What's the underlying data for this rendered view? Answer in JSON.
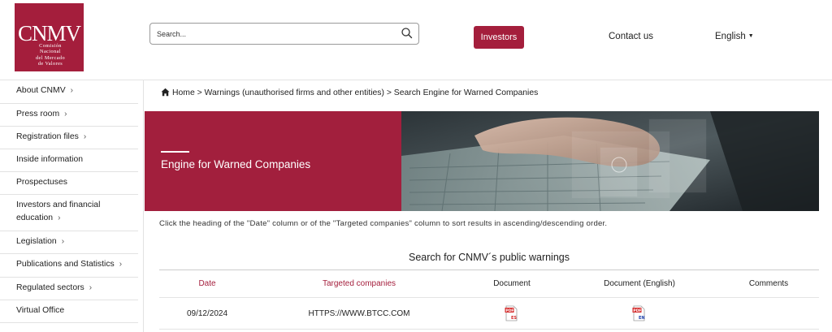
{
  "logo": {
    "brand": "CNMV",
    "lines": [
      "Comisión",
      "Nacional",
      "del Mercado",
      "de Valores"
    ]
  },
  "search": {
    "placeholder": "Search..."
  },
  "header": {
    "investors_label": "Investors",
    "contact_label": "Contact us",
    "language_label": "English"
  },
  "sidebar": {
    "items": [
      {
        "label": "About CNMV",
        "chevron": true
      },
      {
        "label": "Press room",
        "chevron": true
      },
      {
        "label": "Registration files",
        "chevron": true
      },
      {
        "label": "Inside information",
        "chevron": false
      },
      {
        "label": "Prospectuses",
        "chevron": false
      },
      {
        "label": "Investors and financial",
        "label2": "education",
        "chevron": true
      },
      {
        "label": "Legislation",
        "chevron": true
      },
      {
        "label": "Publications and Statistics",
        "chevron": true
      },
      {
        "label": "Regulated sectors",
        "chevron": true
      },
      {
        "label": "Virtual Office",
        "chevron": false
      }
    ]
  },
  "breadcrumb": "Home > Warnings (unauthorised firms and other entities) > Search Engine for Warned Companies",
  "banner": {
    "title": "Engine for Warned Companies"
  },
  "instructions": "Click the heading of the \"Date\" column or of the \"Targeted companies\" column to sort results in ascending/descending order.",
  "table": {
    "title": "Search for CNMV´s public warnings",
    "headers": {
      "date": "Date",
      "companies": "Targeted companies",
      "document": "Document",
      "document_en": "Document (English)",
      "comments": "Comments"
    },
    "rows": [
      {
        "date": "09/12/2024",
        "company": "HTTPS://WWW.BTCC.COM",
        "doc_badge": "ES",
        "doc_en_badge": "EN",
        "comments": ""
      }
    ]
  },
  "colors": {
    "brand": "#a41e3c"
  }
}
